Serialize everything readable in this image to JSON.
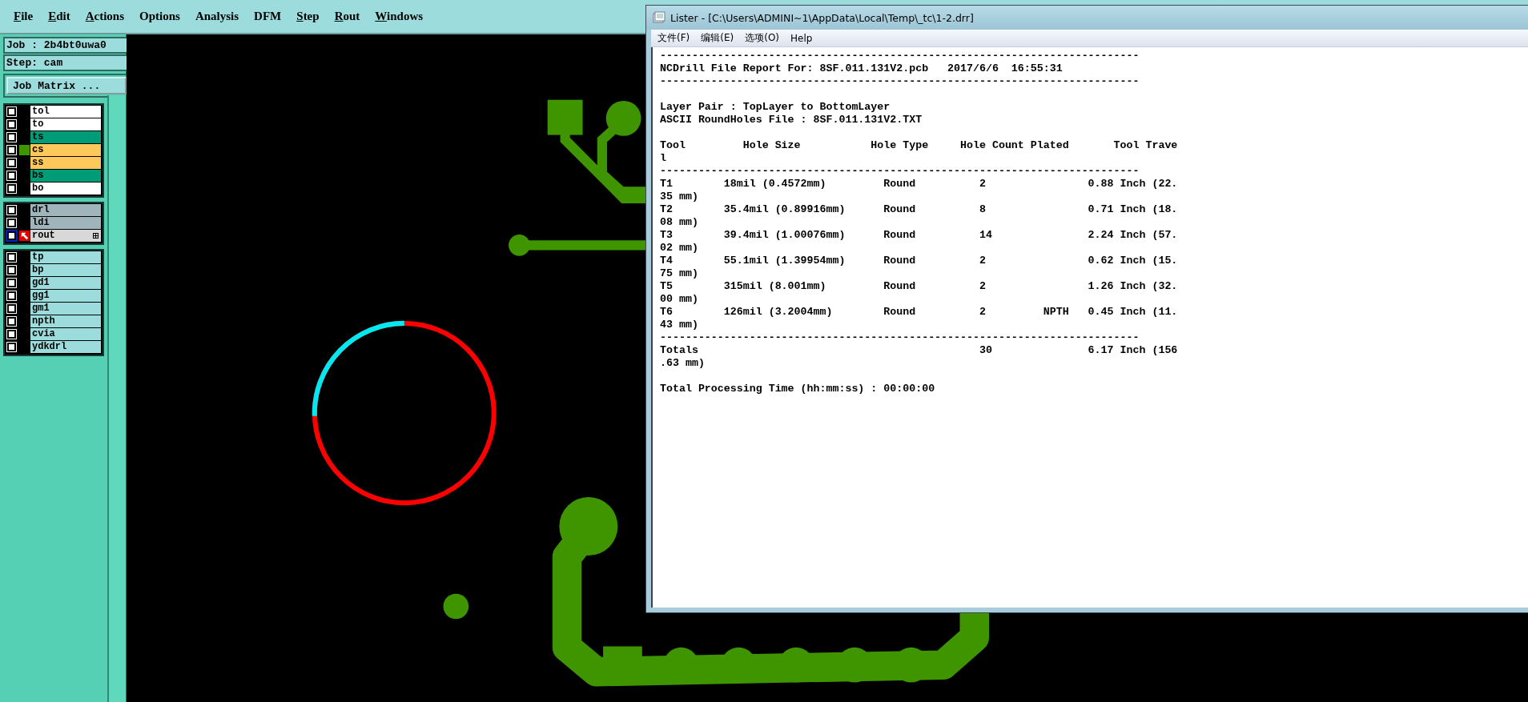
{
  "menu": [
    {
      "label": "File",
      "underlined": true
    },
    {
      "label": "Edit",
      "underlined": true
    },
    {
      "label": "Actions",
      "underlined": true
    },
    {
      "label": "Options",
      "underlined": false
    },
    {
      "label": "Analysis",
      "underlined": false
    },
    {
      "label": "DFM",
      "underlined": false
    },
    {
      "label": "Step",
      "underlined": true
    },
    {
      "label": "Rout",
      "underlined": true
    },
    {
      "label": "Windows",
      "underlined": true
    }
  ],
  "job": "Job : 2b4bt0uwa0",
  "step": "Step: cam",
  "matrix_button": "Job Matrix ...",
  "layer_groups": [
    {
      "layers": [
        {
          "name": "tol",
          "color": "#ffffff",
          "checked": false,
          "shown": false,
          "active": false
        },
        {
          "name": "to",
          "color": "#ffffff",
          "checked": false,
          "shown": false,
          "active": false
        },
        {
          "name": "ts",
          "color": "#009c78",
          "checked": false,
          "shown": false,
          "active": false
        },
        {
          "name": "cs",
          "color": "#ffc85a",
          "checked": false,
          "shown": true,
          "active": false
        },
        {
          "name": "ss",
          "color": "#ffc85a",
          "checked": false,
          "shown": false,
          "active": false
        },
        {
          "name": "bs",
          "color": "#009c78",
          "checked": false,
          "shown": false,
          "active": false
        },
        {
          "name": "bo",
          "color": "#ffffff",
          "checked": false,
          "shown": false,
          "active": false
        }
      ]
    },
    {
      "layers": [
        {
          "name": "drl",
          "color": "#a0b4bc",
          "checked": false,
          "shown": false,
          "active": false
        },
        {
          "name": "ldi",
          "color": "#a0b4bc",
          "checked": false,
          "shown": false,
          "active": false
        },
        {
          "name": "rout",
          "color": "#d8d8d8",
          "checked": false,
          "shown": false,
          "active": true
        }
      ]
    },
    {
      "layers": [
        {
          "name": "tp",
          "color": "#9cdcdc",
          "checked": false,
          "shown": false,
          "active": false
        },
        {
          "name": "bp",
          "color": "#9cdcdc",
          "checked": false,
          "shown": false,
          "active": false
        },
        {
          "name": "gd1",
          "color": "#9cdcdc",
          "checked": false,
          "shown": false,
          "active": false
        },
        {
          "name": "gg1",
          "color": "#9cdcdc",
          "checked": false,
          "shown": false,
          "active": false
        },
        {
          "name": "gm1",
          "color": "#9cdcdc",
          "checked": false,
          "shown": false,
          "active": false
        },
        {
          "name": "npth",
          "color": "#9cdcdc",
          "checked": false,
          "shown": false,
          "active": false
        },
        {
          "name": "cvia",
          "color": "#9cdcdc",
          "checked": false,
          "shown": false,
          "active": false
        },
        {
          "name": "ydkdrl",
          "color": "#9cdcdc",
          "checked": false,
          "shown": false,
          "active": false
        }
      ]
    }
  ],
  "lister": {
    "title": "Lister - [C:\\Users\\ADMINI~1\\AppData\\Local\\Temp\\_tc\\1-2.drr]",
    "menu": [
      "文件(F)",
      "编辑(E)",
      "选项(O)",
      "Help"
    ],
    "report": [
      {
        "lines": [
          "---------------------------------------------------------------------------",
          "NCDrill File Report For: 8SF.011.131V2.pcb   2017/6/6  16:55:31",
          "---------------------------------------------------------------------------"
        ]
      },
      {
        "lines": [
          "Layer Pair : TopLayer to BottomLayer",
          "ASCII RoundHoles File : 8SF.011.131V2.TXT"
        ]
      },
      {
        "lines": [
          "Tool         Hole Size           Hole Type     Hole Count Plated       Tool Trave",
          "l",
          "---------------------------------------------------------------------------",
          "T1        18mil (0.4572mm)         Round          2                0.88 Inch (22.",
          "35 mm)",
          "T2        35.4mil (0.89916mm)      Round          8                0.71 Inch (18.",
          "08 mm)",
          "T3        39.4mil (1.00076mm)      Round          14               2.24 Inch (57.",
          "02 mm)",
          "T4        55.1mil (1.39954mm)      Round          2                0.62 Inch (15.",
          "75 mm)",
          "T5        315mil (8.001mm)         Round          2                1.26 Inch (32.",
          "00 mm)",
          "T6        126mil (3.2004mm)        Round          2         NPTH   0.45 Inch (11.",
          "43 mm)",
          "---------------------------------------------------------------------------",
          "Totals                                            30               6.17 Inch (156",
          ".63 mm)"
        ]
      },
      {
        "lines": [
          "Total Processing Time (hh:mm:ss) : 00:00:00"
        ]
      }
    ]
  }
}
